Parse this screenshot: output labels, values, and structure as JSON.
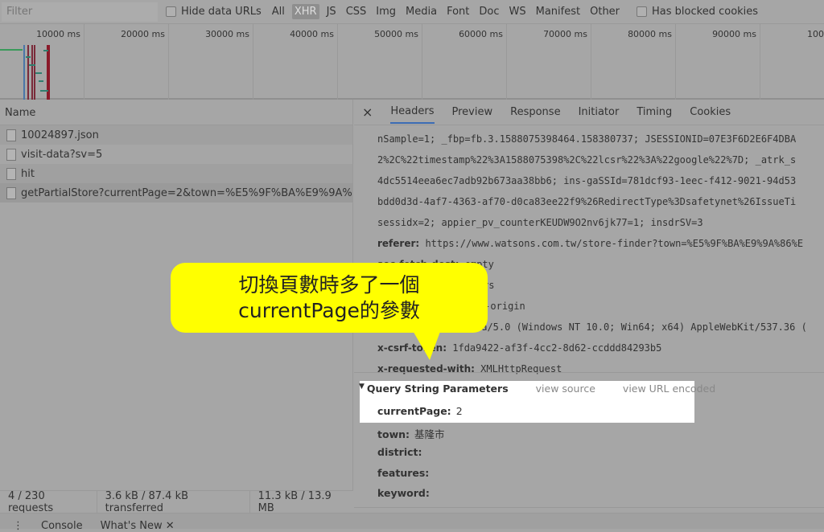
{
  "toolbar": {
    "filter_placeholder": "Filter",
    "hide_data_urls": "Hide data URLs",
    "types": [
      "All",
      "XHR",
      "JS",
      "CSS",
      "Img",
      "Media",
      "Font",
      "Doc",
      "WS",
      "Manifest",
      "Other"
    ],
    "selected_type": "XHR",
    "blocked_cookies": "Has blocked cookies"
  },
  "timeline": {
    "ticks": [
      "10000 ms",
      "20000 ms",
      "30000 ms",
      "40000 ms",
      "50000 ms",
      "60000 ms",
      "70000 ms",
      "80000 ms",
      "90000 ms",
      "100000"
    ]
  },
  "requests": {
    "header": "Name",
    "items": [
      "10024897.json",
      "visit-data?sv=5",
      "hit",
      "getPartialStore?currentPage=2&town=%E5%9F%BA%E9%9A%..."
    ]
  },
  "status": {
    "requests": "4 / 230 requests",
    "transferred": "3.6 kB / 87.4 kB transferred",
    "resources": "11.3 kB / 13.9 MB"
  },
  "drawer": {
    "menu": "⋮",
    "tabs": [
      "Console",
      "What's New ✕"
    ]
  },
  "detail": {
    "close": "×",
    "tabs": [
      "Headers",
      "Preview",
      "Response",
      "Initiator",
      "Timing",
      "Cookies"
    ],
    "active_tab": "Headers",
    "cookie_lines": [
      "nSample=1; _fbp=fb.3.1588075398464.158380737; JSESSIONID=07E3F6D2E6F4DBA",
      "2%2C%22timestamp%22%3A1588075398%2C%22lcsr%22%3A%22google%22%7D; _atrk_s",
      "4dc5514eea6ec7adb92b673aa38bb6; ins-gaSSId=781dcf93-1eec-f412-9021-94d53",
      "bdd0d3d-4af7-4363-af70-d0ca83ee22f9%26RedirectType%3Dsafetynet%26IssueTi",
      "sessidx=2; appier_pv_counterKEUDW9O2nv6jk77=1; insdrSV=3"
    ],
    "headers": [
      {
        "name": "referer:",
        "value": "https://www.watsons.com.tw/store-finder?town=%E5%9F%BA%E9%9A%86%E"
      },
      {
        "name": "sec-fetch-dest:",
        "value": "empty"
      },
      {
        "name": "sec-fetch-mode:",
        "value": "cors"
      },
      {
        "name": "sec-fetch-site:",
        "value": "same-origin"
      },
      {
        "name": "user-agent:",
        "value": "Mozilla/5.0 (Windows NT 10.0; Win64; x64) AppleWebKit/537.36 ("
      },
      {
        "name": "x-csrf-token:",
        "value": "1fda9422-af3f-4cc2-8d62-ccddd84293b5"
      },
      {
        "name": "x-requested-with:",
        "value": "XMLHttpRequest"
      }
    ],
    "query": {
      "title": "Query String Parameters",
      "view_source": "view source",
      "view_url": "view URL encoded",
      "params": [
        {
          "name": "currentPage:",
          "value": "2"
        },
        {
          "name": "town:",
          "value": "基隆市"
        },
        {
          "name": "district:",
          "value": ""
        },
        {
          "name": "features:",
          "value": ""
        },
        {
          "name": "keyword:",
          "value": ""
        }
      ]
    }
  },
  "callout": {
    "line1": "切換頁數時多了一個",
    "line2": "currentPage的參數",
    "color": "#ffff00"
  }
}
